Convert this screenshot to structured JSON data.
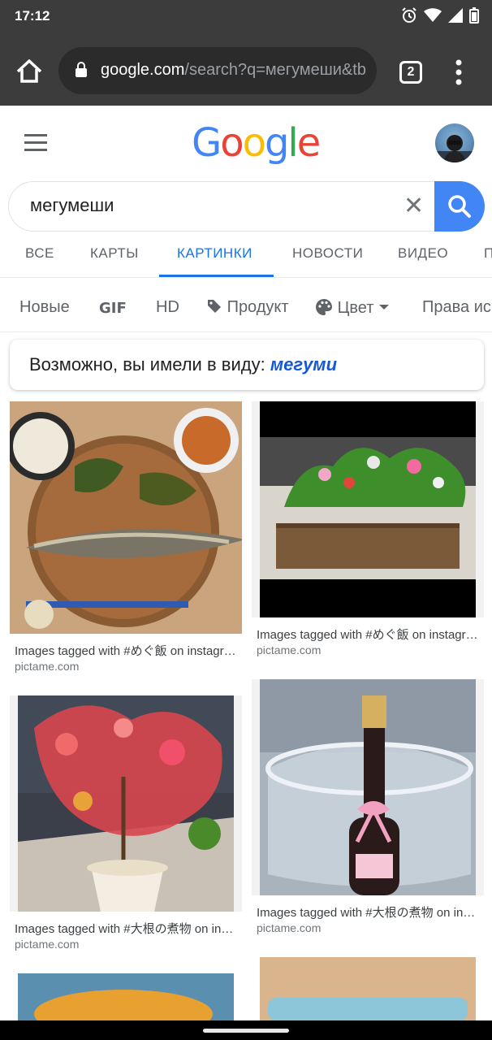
{
  "status": {
    "time": "17:12"
  },
  "browser": {
    "url_host": "google.com",
    "url_path": "/search?q=мегумеши&tb",
    "tab_count": "2"
  },
  "search": {
    "query": "мегумеши",
    "logo": "Google",
    "logo_colors": [
      "#4285f4",
      "#ea4335",
      "#fbbc05",
      "#4285f4",
      "#34a853",
      "#ea4335"
    ]
  },
  "tabs": [
    {
      "label": "ВСЕ"
    },
    {
      "label": "КАРТЫ"
    },
    {
      "label": "КАРТИНКИ"
    },
    {
      "label": "НОВОСТИ"
    },
    {
      "label": "ВИДЕО"
    },
    {
      "label": "П"
    }
  ],
  "chips": [
    {
      "label": "Новые"
    },
    {
      "label": "GIF"
    },
    {
      "label": "HD"
    },
    {
      "label": "Продукт"
    },
    {
      "label": "Цвет"
    },
    {
      "label": "Права ис"
    }
  ],
  "did_you_mean": {
    "prefix": "Возможно, вы имели в виду:",
    "suggestion": "мегуми"
  },
  "results": [
    {
      "caption": "Images tagged with #めぐ飯 on instagram",
      "source": "pictame.com"
    },
    {
      "caption": "Images tagged with #めぐ飯 on instagram",
      "source": "pictame.com"
    },
    {
      "caption": "Images tagged with #大根の煮物 on instagram",
      "source": "pictame.com"
    },
    {
      "caption": "Images tagged with #大根の煮物 on instagram",
      "source": "pictame.com"
    }
  ],
  "colors": {
    "accent": "#1a73e8",
    "chrome": "#3c3c3c",
    "search_button": "#4285f4"
  }
}
